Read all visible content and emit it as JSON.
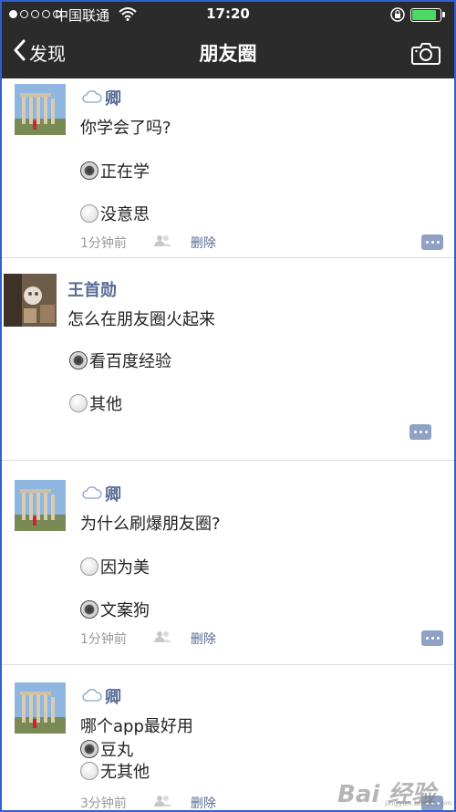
{
  "status": {
    "carrier": "中国联通",
    "time": "17:20",
    "battery_level": 0.9
  },
  "nav": {
    "back_label": "发现",
    "title": "朋友圈"
  },
  "posts": [
    {
      "author": "卿",
      "question": "你学会了吗?",
      "options": [
        {
          "label": "正在学",
          "checked": true
        },
        {
          "label": "没意思",
          "checked": false
        }
      ],
      "time": "1分钟前",
      "delete_label": "删除"
    },
    {
      "author": "王首勋",
      "question": "怎么在朋友圈火起来",
      "options": [
        {
          "label": "看百度经验",
          "checked": true
        },
        {
          "label": "其他",
          "checked": false
        }
      ]
    },
    {
      "author": "卿",
      "question": "为什么刷爆朋友圈?",
      "options": [
        {
          "label": "因为美",
          "checked": false
        },
        {
          "label": "文案狗",
          "checked": true
        }
      ],
      "time": "1分钟前",
      "delete_label": "删除"
    },
    {
      "author": "卿",
      "question": "哪个app最好用",
      "options": [
        {
          "label": "豆丸",
          "checked": true
        },
        {
          "label": "无其他",
          "checked": false
        }
      ],
      "time": "3分钟前",
      "delete_label": "删除"
    }
  ],
  "watermark": {
    "text": "Bai 经验",
    "sub": "jingyan.baidu.com"
  },
  "colors": {
    "bar_background": "#2b2b2b",
    "link_blue": "#576b95",
    "comment_button": "#8fa1c4",
    "battery_green": "#4cd964"
  }
}
